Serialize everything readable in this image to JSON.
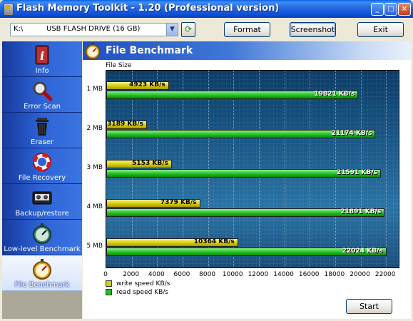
{
  "window": {
    "title": "Flash Memory Toolkit - 1.20 (Professional version)",
    "controls": {
      "minimize": "_",
      "maximize": "□",
      "close": "×"
    }
  },
  "toolbar": {
    "drive_letter": "K:\\",
    "drive_name": "USB FLASH DRIVE (16 GB)",
    "dropdown_icon": "chevron-down-icon",
    "refresh_icon": "refresh-icon",
    "format_label": "Format",
    "screenshot_label": "Screenshot",
    "exit_label": "Exit"
  },
  "sidebar": {
    "items": [
      {
        "label": "Info",
        "icon": "info-icon",
        "active": false
      },
      {
        "label": "Error Scan",
        "icon": "magnifier-icon",
        "active": false
      },
      {
        "label": "Eraser",
        "icon": "trash-can-icon",
        "active": false
      },
      {
        "label": "File Recovery",
        "icon": "lifebuoy-icon",
        "active": false
      },
      {
        "label": "Backup/restore",
        "icon": "tape-icon",
        "active": false
      },
      {
        "label": "Low-level Benchmark",
        "icon": "stopwatch-icon",
        "active": false
      },
      {
        "label": "File Benchmark",
        "icon": "stopwatch-icon",
        "active": true
      }
    ]
  },
  "main": {
    "title": "File Benchmark",
    "title_icon": "stopwatch-icon",
    "start_label": "Start"
  },
  "colors": {
    "write": "#D6CC0A",
    "read": "#22C022",
    "plot_bg": "#1E5E8E"
  },
  "chart_data": {
    "type": "bar",
    "orientation": "horizontal",
    "title": "",
    "ylabel": "File Size",
    "xlabel": "",
    "categories": [
      "1 MB",
      "2 MB",
      "3 MB",
      "4 MB",
      "5 MB"
    ],
    "series": [
      {
        "name": "write speed KB/s",
        "values": [
          4923,
          3189,
          5153,
          7379,
          10364
        ],
        "labels": [
          "4923 KB/s",
          "3189 KB/s",
          "5153 KB/s",
          "7379 KB/s",
          "10364 KB/s"
        ]
      },
      {
        "name": "read speed KB/s",
        "values": [
          19821,
          21174,
          21591,
          21891,
          22024
        ],
        "labels": [
          "19821 KB/s",
          "21174 KB/s",
          "21591 KB/s",
          "21891 KB/s",
          "22024 KB/s"
        ]
      }
    ],
    "xlim": [
      0,
      23000
    ],
    "xticks": [
      0,
      2000,
      4000,
      6000,
      8000,
      10000,
      12000,
      14000,
      16000,
      18000,
      20000,
      22000
    ],
    "xtick_labels": [
      "0",
      "2000",
      "4000",
      "6000",
      "8000",
      "10000",
      "12000",
      "14000",
      "16000",
      "18000",
      "20000",
      "22000"
    ],
    "grid": true,
    "legend": "bottom-left"
  }
}
